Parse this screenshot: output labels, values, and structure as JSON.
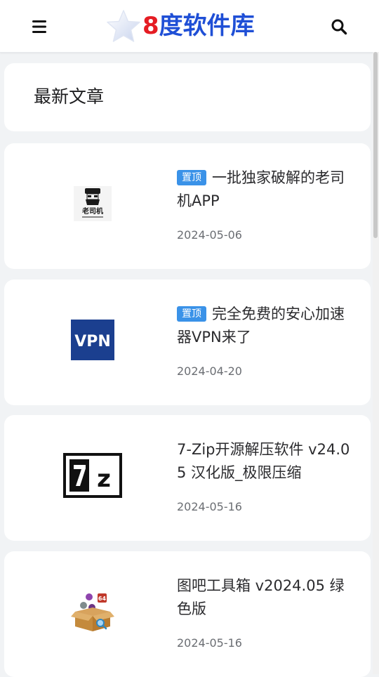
{
  "header": {
    "logo_number": "8",
    "logo_word": "度软件库",
    "menu_icon": "menu-icon",
    "search_icon": "search-icon"
  },
  "section": {
    "title": "最新文章"
  },
  "colors": {
    "logo_red": "#e51c23",
    "logo_blue": "#1f4fd6",
    "pin_badge": "#3a92e8",
    "vpn_blue": "#1b3f8f"
  },
  "posts": [
    {
      "badge": "置顶",
      "title": "一批独家破解的老司机APP",
      "date": "2024-05-06",
      "thumb_label": "老司机"
    },
    {
      "badge": "置顶",
      "title": "完全免费的安心加速器VPN来了",
      "date": "2024-04-20",
      "thumb_label": "VPN"
    },
    {
      "badge": "",
      "title": "7-Zip开源解压软件 v24.05 汉化版_极限压缩",
      "date": "2024-05-16",
      "thumb_label": "7z"
    },
    {
      "badge": "",
      "title": "图吧工具箱 v2024.05 绿色版",
      "date": "2024-05-16",
      "thumb_label": "64"
    }
  ]
}
